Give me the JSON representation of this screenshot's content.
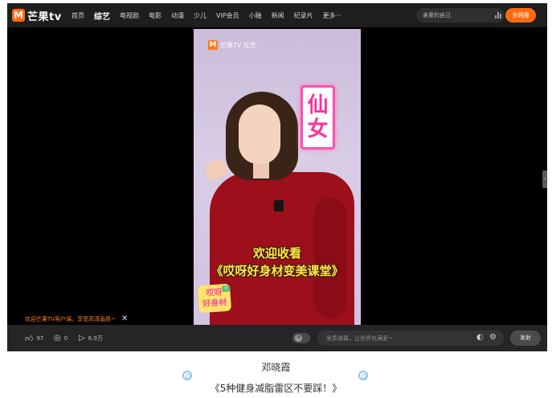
{
  "app": {
    "logo_mark": "M",
    "logo_text": "芒果tv",
    "brand_color": "#ff6a10"
  },
  "nav": {
    "items": [
      {
        "label": "首页",
        "active": false
      },
      {
        "label": "综艺",
        "active": true
      },
      {
        "label": "电视剧",
        "active": false
      },
      {
        "label": "电影",
        "active": false
      },
      {
        "label": "动漫",
        "active": false
      },
      {
        "label": "少儿",
        "active": false
      },
      {
        "label": "VIP会员",
        "active": false
      },
      {
        "label": "小融",
        "active": false
      },
      {
        "label": "新闻",
        "active": false
      },
      {
        "label": "纪录片",
        "active": false
      },
      {
        "label": "更多···",
        "active": false
      }
    ]
  },
  "search": {
    "value": "亲爱的自己",
    "button_label": "全网搜"
  },
  "video": {
    "watermark_mark": "M",
    "watermark_text": "芒果TV 在芒",
    "fairy_chars": [
      "仙",
      "女"
    ],
    "caption_line1": "欢迎收看",
    "caption_line2": "《哎呀好身材变美课堂》",
    "badge_text_line1": "哎呀",
    "badge_text_line2": "好身材",
    "badge_tag": "4"
  },
  "notice": {
    "text": "欢迎芒果TV客户端，享受高清画质~",
    "close_icon": "close-icon"
  },
  "controls": {
    "likes": "97",
    "comments": "0",
    "plays": "6.9万",
    "danmaku_placeholder": "发条弹幕，让世界充满爱~",
    "send_label": "发射",
    "toggle_label": "弹"
  },
  "caption": {
    "name": "邓晓霞",
    "title": "《5种健身减脂雷区不要踩！》"
  }
}
